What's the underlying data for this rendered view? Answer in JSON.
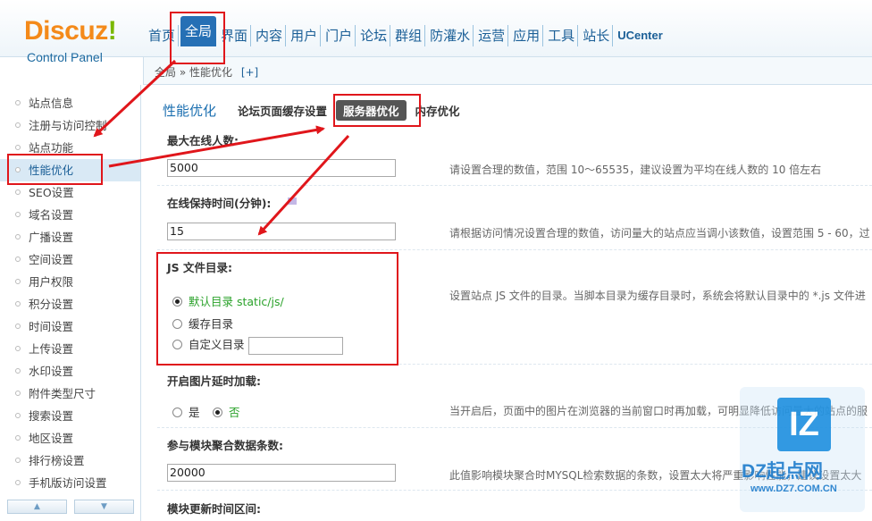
{
  "logo": {
    "brand": "Discuz",
    "bang": "!",
    "subtitle": "Control Panel"
  },
  "topnav": {
    "items": [
      {
        "label": "首页",
        "active": false
      },
      {
        "label": "全局",
        "active": true
      },
      {
        "label": "界面",
        "active": false
      },
      {
        "label": "内容",
        "active": false
      },
      {
        "label": "用户",
        "active": false
      },
      {
        "label": "门户",
        "active": false
      },
      {
        "label": "论坛",
        "active": false
      },
      {
        "label": "群组",
        "active": false
      },
      {
        "label": "防灌水",
        "active": false
      },
      {
        "label": "运营",
        "active": false
      },
      {
        "label": "应用",
        "active": false
      },
      {
        "label": "工具",
        "active": false
      },
      {
        "label": "站长",
        "active": false
      },
      {
        "label": "UCenter",
        "active": false
      }
    ]
  },
  "breadcrumb": {
    "text": "全局 » 性能优化",
    "add": "[+]"
  },
  "sidebar": {
    "items": [
      {
        "label": "站点信息"
      },
      {
        "label": "注册与访问控制"
      },
      {
        "label": "站点功能"
      },
      {
        "label": "性能优化",
        "active": true
      },
      {
        "label": "SEO设置"
      },
      {
        "label": "域名设置"
      },
      {
        "label": "广播设置"
      },
      {
        "label": "空间设置"
      },
      {
        "label": "用户权限"
      },
      {
        "label": "积分设置"
      },
      {
        "label": "时间设置"
      },
      {
        "label": "上传设置"
      },
      {
        "label": "水印设置"
      },
      {
        "label": "附件类型尺寸"
      },
      {
        "label": "搜索设置"
      },
      {
        "label": "地区设置"
      },
      {
        "label": "排行榜设置"
      },
      {
        "label": "手机版访问设置"
      }
    ],
    "scroll_up": "▲",
    "scroll_down": "▼"
  },
  "main": {
    "page_title": "性能优化",
    "tabs": [
      {
        "label": "论坛页面缓存设置",
        "active": false
      },
      {
        "label": "服务器优化",
        "active": true
      },
      {
        "label": "内存优化",
        "active": false
      }
    ],
    "fields": {
      "max_online": {
        "label": "最大在线人数:",
        "value": "5000",
        "tip": "请设置合理的数值，范围 10～65535，建议设置为平均在线人数的 10 倍左右"
      },
      "online_hold": {
        "label": "在线保持时间(分钟):",
        "value": "15",
        "tip": "请根据访问情况设置合理的数值，访问量大的站点应当调小该数值，设置范围 5 - 60，过"
      },
      "js_dir": {
        "label": "JS 文件目录:",
        "options": [
          "默认目录 static/js/",
          "缓存目录",
          "自定义目录"
        ],
        "tip": "设置站点 JS 文件的目录。当脚本目录为缓存目录时，系统会将默认目录中的 *.js 文件进"
      },
      "lazyload": {
        "label": "开启图片延时加载:",
        "yes": "是",
        "no": "否",
        "tip": "当开启后，页面中的图片在浏览器的当前窗口时再加载，可明显降低访问量大的站点的服"
      },
      "block_max": {
        "label": "参与模块聚合数据条数:",
        "value": "20000",
        "tip": "此值影响模块聚合时MYSQL检索数据的条数，设置太大将严重影响性能，建议设置太大"
      },
      "block_refresh": {
        "label": "模块更新时间区间:"
      }
    }
  },
  "watermark": {
    "tile": "IZ",
    "name": "DZ起点网",
    "url": "www.DZ7.COM.CN"
  },
  "colors": {
    "accent": "#2670b5",
    "annotation": "#e0161b",
    "logo_orange": "#f48a1a",
    "logo_green": "#7ab800"
  }
}
